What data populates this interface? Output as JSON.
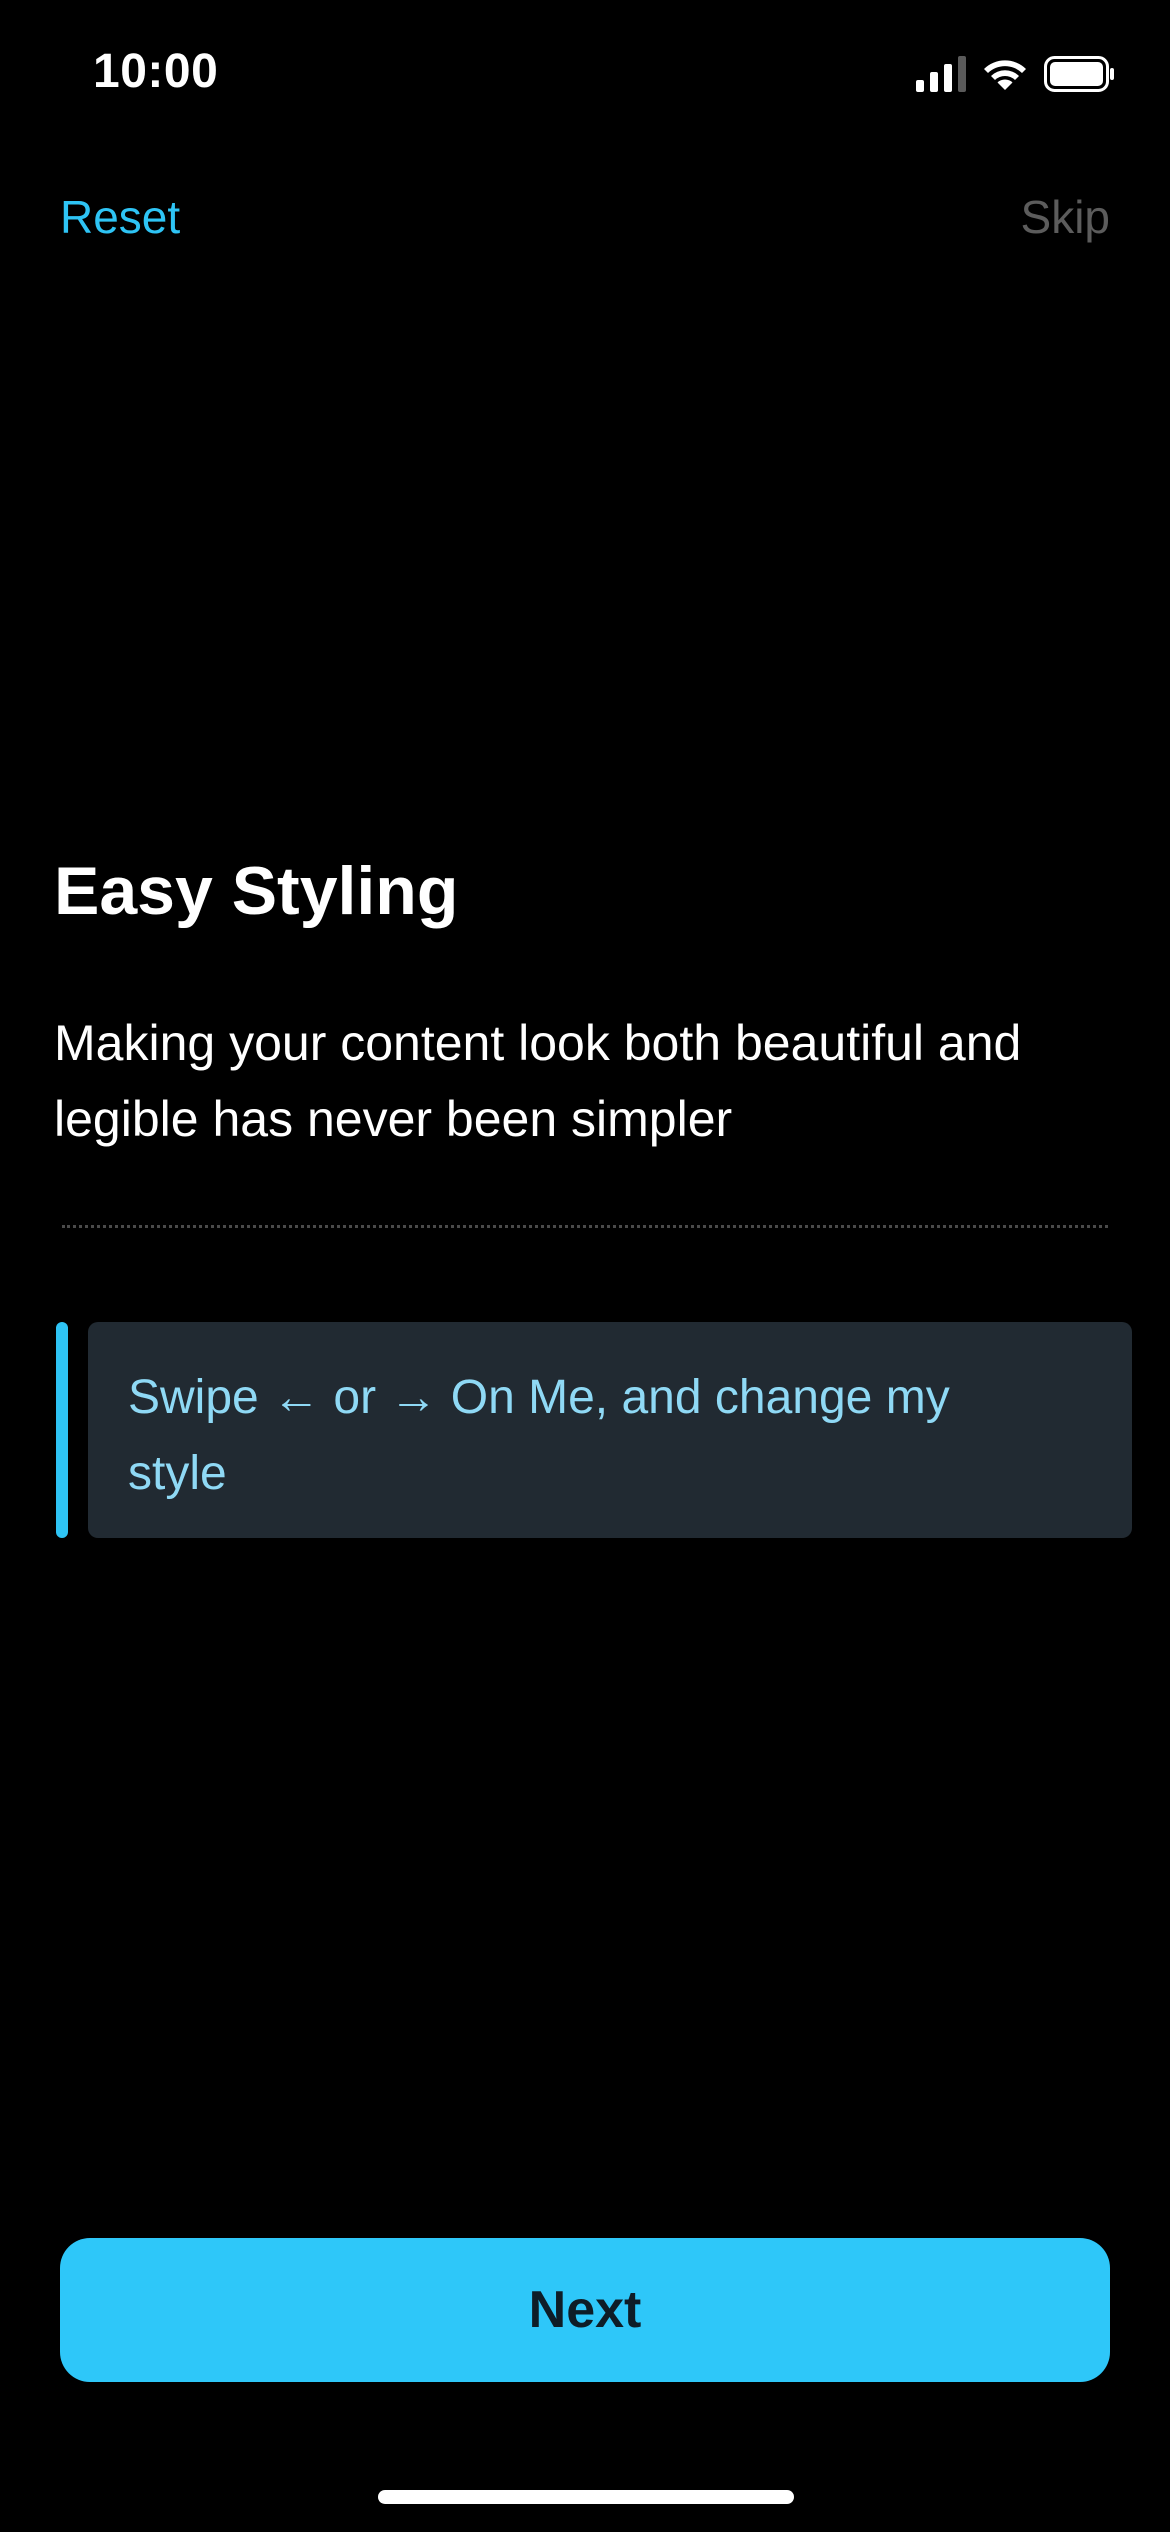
{
  "status_bar": {
    "time": "10:00",
    "signal_icon": "cellular-signal-icon",
    "wifi_icon": "wifi-icon",
    "battery_icon": "battery-full-icon"
  },
  "nav": {
    "reset_label": "Reset",
    "skip_label": "Skip"
  },
  "content": {
    "title": "Easy Styling",
    "description": "Making your content look both beautiful and legible has never been simpler",
    "callout_text": "Swipe ← or → On Me, and change my style"
  },
  "footer": {
    "next_label": "Next"
  },
  "colors": {
    "background": "#000000",
    "accent": "#2ec4f5",
    "callout_text": "#8fd9f5",
    "callout_background": "#212a32",
    "muted_text": "#5c5c5c"
  }
}
